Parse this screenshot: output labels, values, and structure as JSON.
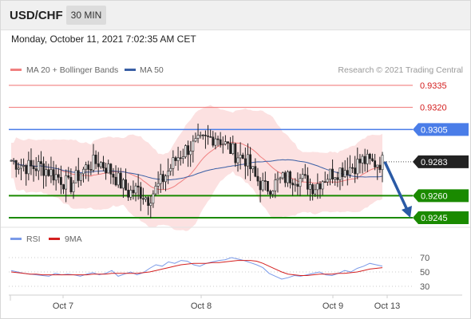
{
  "header": {
    "symbol": "USD/CHF",
    "timeframe": "30 MIN",
    "datetime": "Monday, October 11, 2021 7:02:35 AM CET"
  },
  "legend": {
    "ma20": "MA 20 + Bollinger Bands",
    "ma50": "MA 50",
    "credit": "Research © 2021 Trading Central",
    "rsi": "RSI",
    "rsi_ma": "9MA"
  },
  "colors": {
    "ma20": "#f08080",
    "ma50": "#3a5fa5",
    "resistance": "#f07070",
    "pivot": "#4a7de8",
    "support": "#1a8a00",
    "arrow": "#2a5aa5",
    "candle": "#222222",
    "band_fill": "#fbd9d9",
    "rsi": "#7a9ae8",
    "rsi_ma": "#d42020"
  },
  "chart_data": [
    {
      "type": "candlestick",
      "y_range": [
        0.9235,
        0.9342
      ],
      "x_labels": [
        "Oct 7",
        "Oct 8",
        "Oct 9",
        "Oct 13"
      ],
      "current_price": "0.9283",
      "levels": [
        {
          "label": "0.9335",
          "value": 0.9335,
          "role": "resistance",
          "style": "thin"
        },
        {
          "label": "0.9320",
          "value": 0.932,
          "role": "resistance",
          "style": "thin"
        },
        {
          "label": "0.9305",
          "value": 0.9305,
          "role": "pivot",
          "style": "medium"
        },
        {
          "label": "0.9260",
          "value": 0.926,
          "role": "support",
          "style": "thick"
        },
        {
          "label": "0.9245",
          "value": 0.9245,
          "role": "support",
          "style": "thick"
        }
      ],
      "projection": {
        "from": 0.9283,
        "to": 0.9245
      },
      "price_path": [
        0.9284,
        0.9281,
        0.9279,
        0.928,
        0.9276,
        0.9272,
        0.9266,
        0.9275,
        0.9281,
        0.9283,
        0.9278,
        0.927,
        0.9262,
        0.9264,
        0.9258,
        0.9266,
        0.9276,
        0.9286,
        0.9292,
        0.9295,
        0.9298,
        0.9301,
        0.9294,
        0.9288,
        0.9285,
        0.9272,
        0.9265,
        0.9268,
        0.9272,
        0.9273,
        0.927,
        0.9266,
        0.9272,
        0.9276,
        0.9278,
        0.928,
        0.9284,
        0.9282,
        0.9283
      ]
    },
    {
      "type": "line",
      "title": "RSI",
      "y_ticks": [
        70,
        50,
        30
      ],
      "series": [
        {
          "name": "RSI",
          "values": [
            52,
            50,
            48,
            47,
            46,
            45,
            44,
            48,
            46,
            47,
            46,
            44,
            47,
            49,
            46,
            48,
            52,
            44,
            47,
            50,
            46,
            49,
            55,
            60,
            58,
            64,
            62,
            66,
            65,
            60,
            58,
            62,
            64,
            66,
            67,
            70,
            68,
            66,
            63,
            60,
            56,
            48,
            44,
            40,
            42,
            45,
            44,
            46,
            48,
            50,
            46,
            45,
            48,
            52,
            50,
            55,
            58,
            62,
            60,
            58
          ]
        },
        {
          "name": "9MA",
          "values": [
            50,
            49,
            48,
            47,
            47,
            46,
            46,
            46,
            46,
            46,
            46,
            46,
            46,
            47,
            47,
            47,
            48,
            48,
            48,
            48,
            48,
            49,
            50,
            52,
            54,
            56,
            58,
            60,
            61,
            62,
            62,
            62,
            63,
            63,
            64,
            65,
            66,
            66,
            66,
            65,
            62,
            58,
            54,
            50,
            47,
            46,
            45,
            45,
            46,
            47,
            47,
            47,
            48,
            48,
            49,
            50,
            52,
            54,
            55,
            56
          ]
        }
      ]
    }
  ]
}
